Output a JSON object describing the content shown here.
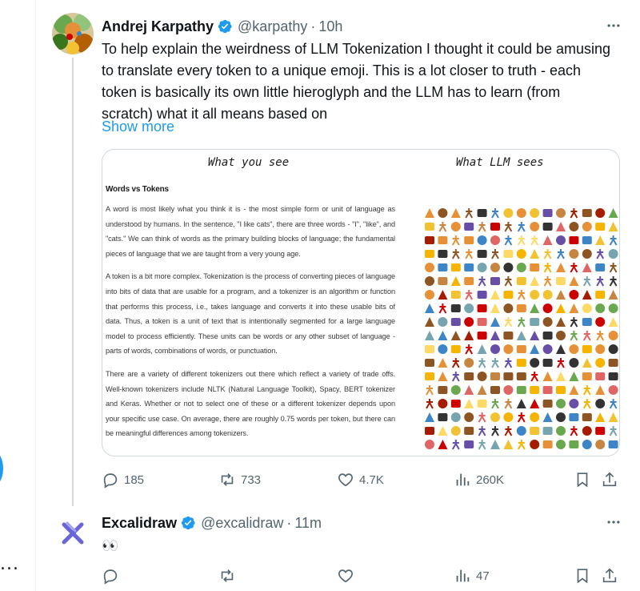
{
  "left_panel": {
    "more_label": "..."
  },
  "tweets": [
    {
      "author_name": "Andrej Karpathy",
      "handle": "@karpathy",
      "separator": "·",
      "time": "10h",
      "text": "To help explain the weirdness of LLM Tokenization I thought it could be amusing to translate every token to a unique emoji. This is a lot closer to truth - each token is basically its own little hieroglyph and the LLM has to learn (from scratch) what it all means based on",
      "show_more": "Show more",
      "media": {
        "left_caption": "What you see",
        "right_caption": "What LLM sees",
        "heading": "Words vs Tokens",
        "paragraphs": [
          "A word is most likely what you think it is - the most simple form or unit of language as understood by humans. In the sentence, \"I like cats\", there are three words - \"I\", \"like\", and \"cats.\" We can think of words as the primary building blocks of language; the fundamental pieces of language that we are taught from a very young age.",
          "A token is a bit more complex. Tokenization is the process of converting pieces of language into bits of data that are usable for a program, and a tokenizer is an algorithm or function that performs this process, i.e., takes language and converts it into these usable bits of data. Thus, a token is a unit of text that is intentionally segmented for a large language model to process efficiently. These units can be words or any other subset of language - parts of words, combinations of words, or punctuation.",
          "There are a variety of different tokenizers out there which reflect a variety of trade offs. Well-known tokenizers include NLTK (Natural Language Toolkit), Spacy, BERT tokenizer and Keras. Whether or not to select one of these or a different tokenizer depends upon your specific use case. On average, there are roughly 0.75 words per token, but there can be meaningful differences among tokenizers."
        ]
      },
      "stats": {
        "replies": "185",
        "reposts": "733",
        "likes": "4.7K",
        "views": "260K"
      }
    },
    {
      "author_name": "Excalidraw",
      "handle": "@excalidraw",
      "separator": "·",
      "time": "11m",
      "text": "👀",
      "stats": {
        "replies": "",
        "reposts": "",
        "likes": "",
        "views": "47"
      }
    }
  ],
  "colors": {
    "accent": "#1d9bf0",
    "muted": "#536471",
    "text": "#0f1419",
    "excalidraw": "#6965db"
  }
}
